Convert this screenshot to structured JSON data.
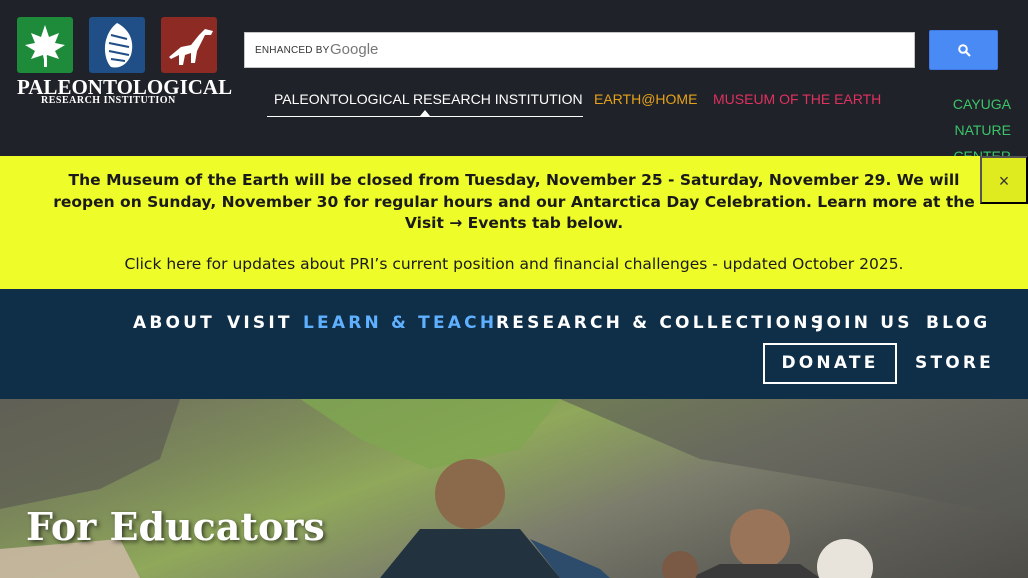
{
  "header": {
    "logo_title": "PALEONTOLOGICAL",
    "logo_subtitle": "RESEARCH INSTITUTION",
    "search": {
      "enhanced_label": "ENHANCED BY",
      "google_label": "Google",
      "placeholder": "",
      "button_icon": "search-icon"
    },
    "site_links": [
      {
        "label": "PALEONTOLOGICAL RESEARCH INSTITUTION",
        "color": "#ffffff",
        "active": true
      },
      {
        "label": "EARTH@HOME",
        "color": "#e6a21a"
      },
      {
        "label": "MUSEUM OF THE EARTH",
        "color": "#e0315f"
      },
      {
        "label": "CAYUGA NATURE CENTER",
        "color": "#3cc46a"
      }
    ]
  },
  "alert": {
    "message": "The Museum of the Earth will be closed from Tuesday, November 25 - Saturday, November 29. We will reopen on Sunday, November 30 for regular hours and our Antarctica Day Celebration. Learn more at the Visit → Events tab below.",
    "update_link": "Click here for updates about PRI’s current position and financial challenges - updated October 2025.",
    "close_label": "×",
    "background": "#eefc29"
  },
  "nav": {
    "items": [
      "ABOUT",
      "VISIT",
      "LEARN & TEACH",
      "RESEARCH & COLLECTIONS",
      "JOIN US",
      "BLOG"
    ],
    "active": "LEARN & TEACH",
    "donate": "DONATE",
    "store": "STORE",
    "background": "#0f2e47",
    "active_color": "#5fb0ff"
  },
  "hero": {
    "title": "For Educators"
  }
}
